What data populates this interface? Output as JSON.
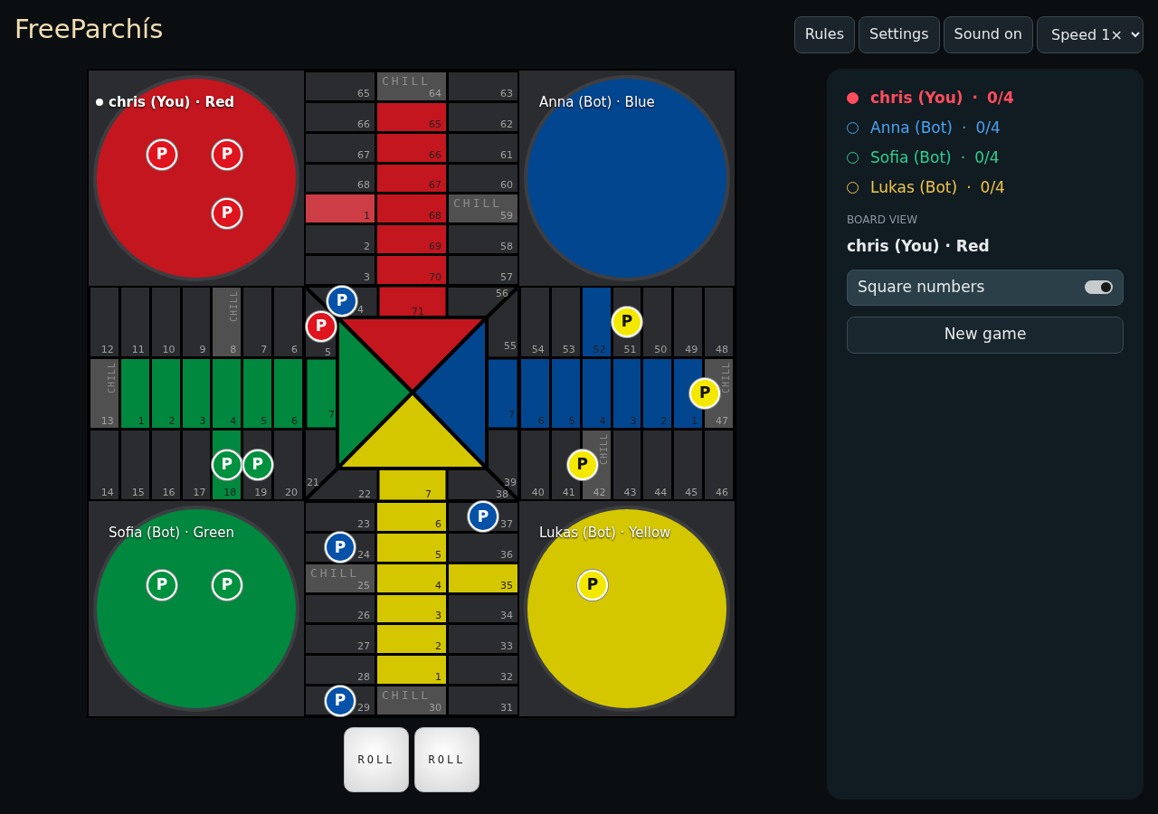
{
  "header": {
    "title": "FreeParchís",
    "buttons": [
      "Rules",
      "Settings",
      "Sound on"
    ],
    "speed": "Speed 1×"
  },
  "nests": [
    {
      "label": "chris (You) · Red",
      "active": true,
      "color": "#c3161f",
      "pieces": [
        {
          "label": "P",
          "color": "#e0141e"
        },
        {
          "label": "P",
          "color": "#e0141e"
        },
        {
          "label": "P",
          "color": "#e0141e"
        }
      ]
    },
    {
      "label": "Anna (Bot) · Blue",
      "active": false,
      "color": "#02468f"
    },
    {
      "label": "Sofia (Bot) · Green",
      "active": false,
      "color": "#00883f",
      "pieces": [
        {
          "label": "P",
          "color": "#00913f"
        },
        {
          "label": "P",
          "color": "#00913f"
        }
      ]
    },
    {
      "label": "Lukas (Bot) · Yellow",
      "active": false,
      "color": "#d4c700",
      "pieces": [
        {
          "label": "P",
          "color": "#f5e800"
        }
      ]
    }
  ],
  "arms": [
    {
      "rows": [
        [
          {
            "kind": "plain",
            "number": "65"
          },
          {
            "kind": "chill",
            "number": "64",
            "tag": "CHILL"
          },
          {
            "kind": "plain",
            "number": "63"
          }
        ],
        [
          {
            "kind": "plain",
            "number": "66"
          },
          {
            "kind": "lane",
            "number": "65",
            "color": "#c3161f"
          },
          {
            "kind": "plain",
            "number": "62"
          }
        ],
        [
          {
            "kind": "plain",
            "number": "67"
          },
          {
            "kind": "lane",
            "number": "66",
            "color": "#c3161f"
          },
          {
            "kind": "plain",
            "number": "61"
          }
        ],
        [
          {
            "kind": "plain",
            "number": "68"
          },
          {
            "kind": "lane",
            "number": "67",
            "color": "#c3161f"
          },
          {
            "kind": "plain",
            "number": "60"
          }
        ],
        [
          {
            "kind": "lane",
            "number": "1",
            "color": "#cc3d45"
          },
          {
            "kind": "lane",
            "number": "68",
            "color": "#c3161f"
          },
          {
            "kind": "chill",
            "number": "59",
            "tag": "CHILL"
          }
        ],
        [
          {
            "kind": "plain",
            "number": "2"
          },
          {
            "kind": "lane",
            "number": "69",
            "color": "#c3161f"
          },
          {
            "kind": "plain",
            "number": "58"
          }
        ],
        [
          {
            "kind": "plain",
            "number": "3"
          },
          {
            "kind": "lane",
            "number": "70",
            "color": "#c3161f"
          },
          {
            "kind": "plain",
            "number": "57"
          }
        ]
      ]
    },
    {
      "rows": [
        [
          {
            "kind": "plain",
            "number": "12"
          },
          {
            "kind": "plain",
            "number": "11"
          },
          {
            "kind": "plain",
            "number": "10"
          },
          {
            "kind": "plain",
            "number": "9"
          },
          {
            "kind": "chill",
            "number": "8",
            "tag": "CHILL"
          },
          {
            "kind": "plain",
            "number": "7"
          },
          {
            "kind": "plain",
            "number": "6"
          }
        ],
        [
          {
            "kind": "chill",
            "number": "13",
            "tag": "CHILL"
          },
          {
            "kind": "lane",
            "number": "1",
            "color": "#00883f"
          },
          {
            "kind": "lane",
            "number": "2",
            "color": "#00883f"
          },
          {
            "kind": "lane",
            "number": "3",
            "color": "#00883f"
          },
          {
            "kind": "lane",
            "number": "4",
            "color": "#00883f"
          },
          {
            "kind": "lane",
            "number": "5",
            "color": "#00883f"
          },
          {
            "kind": "lane",
            "number": "6",
            "color": "#00883f"
          }
        ],
        [
          {
            "kind": "plain",
            "number": "14"
          },
          {
            "kind": "plain",
            "number": "15"
          },
          {
            "kind": "plain",
            "number": "16"
          },
          {
            "kind": "plain",
            "number": "17"
          },
          {
            "kind": "lane",
            "number": "18",
            "color": "#00883f",
            "pieces": [
              {
                "label": "P",
                "color": "#00913f"
              }
            ]
          },
          {
            "kind": "plain",
            "number": "19",
            "pieces": [
              {
                "label": "P",
                "color": "#00913f"
              }
            ]
          },
          {
            "kind": "plain",
            "number": "20"
          }
        ]
      ]
    },
    {
      "rows": [
        [
          {
            "kind": "plain",
            "number": "54"
          },
          {
            "kind": "plain",
            "number": "53"
          },
          {
            "kind": "lane",
            "number": "52",
            "color": "#02468f"
          },
          {
            "kind": "plain",
            "number": "51",
            "pieces": [
              {
                "label": "P",
                "color": "#f5e800"
              }
            ]
          },
          {
            "kind": "plain",
            "number": "50"
          },
          {
            "kind": "plain",
            "number": "49"
          },
          {
            "kind": "plain",
            "number": "48"
          }
        ],
        [
          {
            "kind": "lane",
            "number": "6",
            "color": "#02468f"
          },
          {
            "kind": "lane",
            "number": "5",
            "color": "#02468f"
          },
          {
            "kind": "lane",
            "number": "4",
            "color": "#02468f"
          },
          {
            "kind": "lane",
            "number": "3",
            "color": "#02468f"
          },
          {
            "kind": "lane",
            "number": "2",
            "color": "#02468f"
          },
          {
            "kind": "lane",
            "number": "1",
            "color": "#02468f"
          },
          {
            "kind": "chill",
            "number": "47",
            "tag": "CHILL",
            "pieces": [
              {
                "label": "P",
                "color": "#f5e800"
              }
            ]
          }
        ],
        [
          {
            "kind": "plain",
            "number": "40"
          },
          {
            "kind": "plain",
            "number": "41"
          },
          {
            "kind": "chill",
            "number": "42",
            "tag": "CHILL",
            "pieces": [
              {
                "label": "P",
                "color": "#f5e800"
              }
            ]
          },
          {
            "kind": "plain",
            "number": "43"
          },
          {
            "kind": "plain",
            "number": "44"
          },
          {
            "kind": "plain",
            "number": "45"
          },
          {
            "kind": "plain",
            "number": "46"
          }
        ]
      ]
    },
    {
      "rows": [
        [
          {
            "kind": "plain",
            "number": "23"
          },
          {
            "kind": "lane",
            "number": "6",
            "color": "#d4c700"
          },
          {
            "kind": "plain",
            "number": "37",
            "pieces": [
              {
                "label": "P",
                "color": "#0652a8"
              }
            ]
          }
        ],
        [
          {
            "kind": "plain",
            "number": "24",
            "pieces": [
              {
                "label": "P",
                "color": "#0652a8"
              }
            ]
          },
          {
            "kind": "lane",
            "number": "5",
            "color": "#d4c700"
          },
          {
            "kind": "plain",
            "number": "36"
          }
        ],
        [
          {
            "kind": "chill",
            "number": "25",
            "tag": "CHILL"
          },
          {
            "kind": "lane",
            "number": "4",
            "color": "#d4c700"
          },
          {
            "kind": "lane",
            "number": "35",
            "color": "#d4c700"
          }
        ],
        [
          {
            "kind": "plain",
            "number": "26"
          },
          {
            "kind": "lane",
            "number": "3",
            "color": "#d4c700"
          },
          {
            "kind": "plain",
            "number": "34"
          }
        ],
        [
          {
            "kind": "plain",
            "number": "27"
          },
          {
            "kind": "lane",
            "number": "2",
            "color": "#d4c700"
          },
          {
            "kind": "plain",
            "number": "33"
          }
        ],
        [
          {
            "kind": "plain",
            "number": "28"
          },
          {
            "kind": "lane",
            "number": "1",
            "color": "#d4c700"
          },
          {
            "kind": "plain",
            "number": "32"
          }
        ],
        [
          {
            "kind": "plain",
            "number": "29",
            "pieces": [
              {
                "label": "P",
                "color": "#0652a8"
              }
            ]
          },
          {
            "kind": "chill",
            "number": "30",
            "tag": "CHILL"
          },
          {
            "kind": "plain",
            "number": "31"
          }
        ]
      ]
    }
  ],
  "center": {
    "cells": [
      {
        "kind": "plain",
        "number": "4",
        "pieces": [
          {
            "label": "P",
            "color": "#0652a8"
          }
        ]
      },
      {
        "kind": "plain",
        "number": "5",
        "pieces": [
          {
            "label": "P",
            "color": "#e0141e"
          }
        ]
      },
      {
        "kind": "lane",
        "number": "71",
        "color": "#c3161f"
      },
      {
        "kind": "plain",
        "number": "56"
      },
      {
        "kind": "plain",
        "number": "55"
      },
      {
        "kind": "lane",
        "number": "7",
        "color": "#00883f"
      },
      {
        "kind": "lane",
        "number": "7",
        "color": "#02468f"
      },
      {
        "kind": "plain",
        "number": "21"
      },
      {
        "kind": "plain",
        "number": "22"
      },
      {
        "kind": "lane",
        "number": "7",
        "color": "#d4c700"
      },
      {
        "kind": "plain",
        "number": "39"
      },
      {
        "kind": "plain",
        "number": "38"
      }
    ],
    "goal": [
      {
        "color": "#c3161f"
      },
      {
        "color": "#00883f"
      },
      {
        "color": "#02468f"
      },
      {
        "color": "#d4c700"
      }
    ]
  },
  "dice": [
    "ROLL",
    "ROLL"
  ],
  "panel": {
    "players": [
      {
        "name": "chris (You)",
        "score": "0/4",
        "separator": "·",
        "color": "#ff4d5e",
        "selected": true
      },
      {
        "name": "Anna (Bot)",
        "score": "0/4",
        "separator": "·",
        "color": "#4aa3f0",
        "selected": false
      },
      {
        "name": "Sofia (Bot)",
        "score": "0/4",
        "separator": "·",
        "color": "#2fcf8f",
        "selected": false
      },
      {
        "name": "Lukas (Bot)",
        "score": "0/4",
        "separator": "·",
        "color": "#f0c64a",
        "selected": false
      }
    ],
    "section_label": "BOARD VIEW",
    "view": "chris (You) · Red",
    "toggle": {
      "label": "Square numbers",
      "on": true
    },
    "new_game": "New game"
  }
}
